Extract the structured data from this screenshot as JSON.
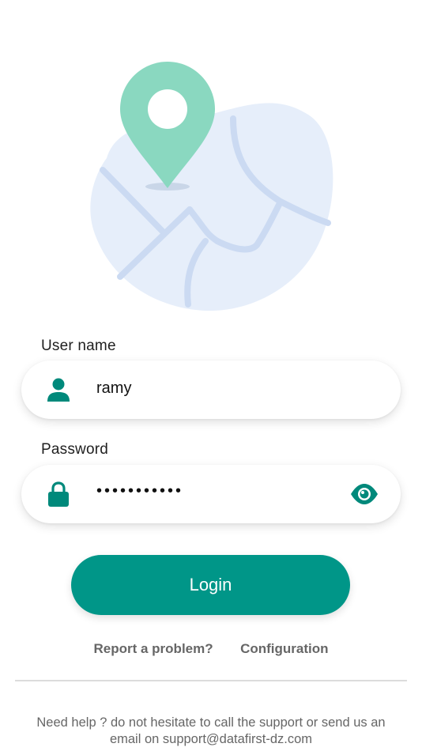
{
  "form": {
    "username_label": "User name",
    "username_value": "ramy",
    "password_label": "Password",
    "password_value": "•••••••••••",
    "login_label": "Login"
  },
  "links": {
    "report_problem": "Report a problem?",
    "configuration": "Configuration"
  },
  "footer": {
    "help_text": "Need help ? do not hesitate to call the support or send us an email on support@datafirst-dz.com"
  },
  "icons": {
    "username": "person-icon",
    "password": "lock-icon",
    "toggle_password": "eye-icon",
    "hero": "map-pin-illustration"
  },
  "colors": {
    "accent": "#009688",
    "pin": "#8ad8c0",
    "map_blob": "#e6eefa",
    "map_roads": "#cbdaf2"
  }
}
